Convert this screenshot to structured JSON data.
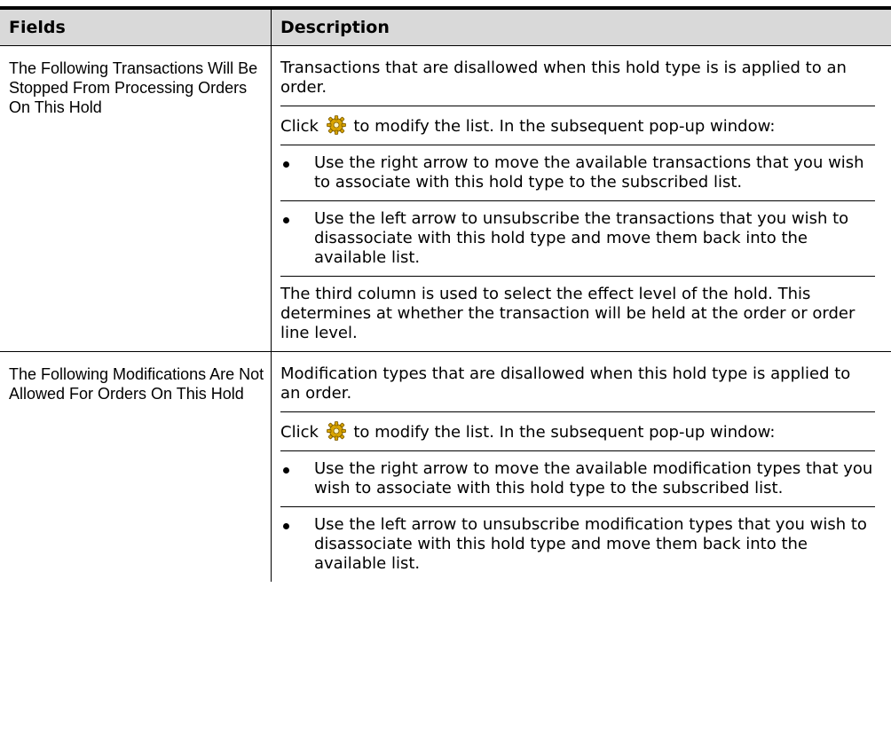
{
  "table": {
    "headers": {
      "fields": "Fields",
      "description": "Description"
    },
    "rows": [
      {
        "field": "The Following Transactions Will Be Stopped From Processing Orders On This Hold",
        "intro": "Transactions that are disallowed when this hold type is is applied to an order.",
        "click_before": "Click",
        "click_after": "to modify the list. In the subsequent pop-up window:",
        "bullets": [
          "Use the right arrow to move the available transactions that you wish to associate with this hold type to the subscribed list.",
          "Use the left arrow to unsubscribe the transactions that you wish to disassociate with this hold type and move them back into the available list."
        ],
        "note": "The third column is used to select the effect level of the hold. This determines at whether the transaction will be held at the order or order line level."
      },
      {
        "field": "The Following Modifications Are Not Allowed For Orders On This Hold",
        "intro": "Modification types that are disallowed when this hold type is applied to an order.",
        "click_before": "Click",
        "click_after": "to modify the list. In the subsequent pop-up window:",
        "bullets": [
          "Use the right arrow to move the available modification types that you wish to associate with this hold type to the subscribed list.",
          "Use the left arrow to unsubscribe modification types that you wish to disassociate with this hold type and move them back into the available list."
        ]
      }
    ]
  },
  "icons": {
    "modify": "gear-icon"
  },
  "colors": {
    "header_bg": "#d9d9d9",
    "gear": "#d9a400"
  }
}
